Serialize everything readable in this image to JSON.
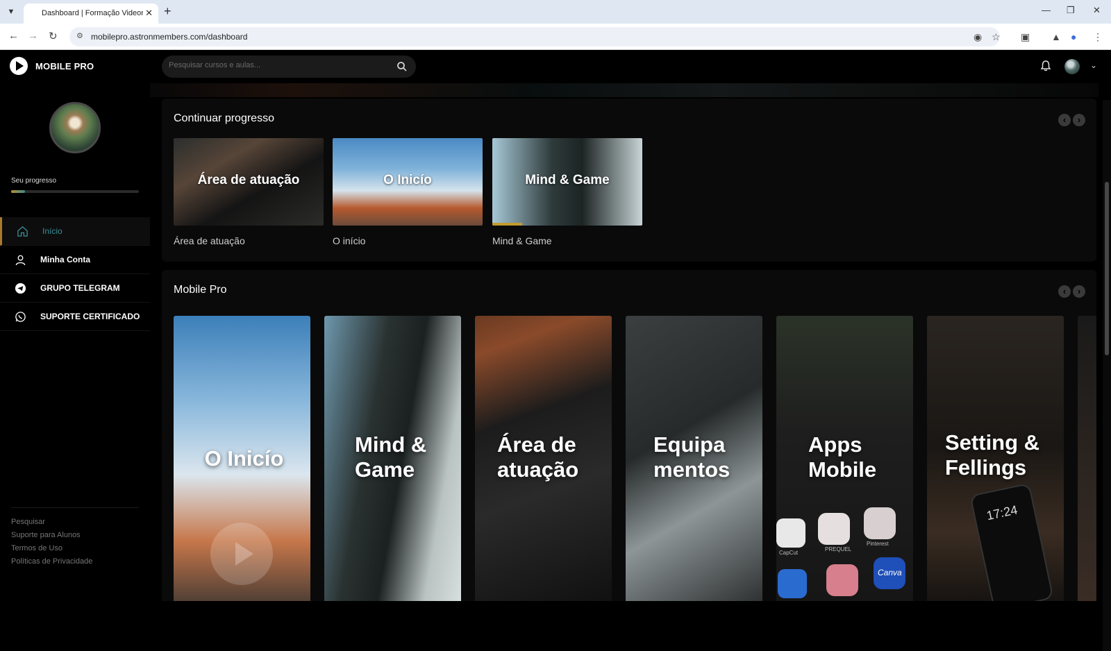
{
  "browser": {
    "tab_title": "Dashboard | Formação Videomaker Mobile Pro",
    "url": "mobilepro.astronmembers.com/dashboard"
  },
  "app": {
    "logo_text": "MOBILE PRO",
    "search_placeholder": "Pesquisar cursos e aulas..."
  },
  "sidebar": {
    "progress_label": "Seu progresso",
    "progress_value": 0.11,
    "nav": [
      {
        "label": "Início",
        "icon": "home-icon",
        "active": true
      },
      {
        "label": "Minha Conta",
        "icon": "user-icon",
        "active": false
      },
      {
        "label": "GRUPO TELEGRAM",
        "icon": "telegram-icon",
        "active": false
      },
      {
        "label": "SUPORTE CERTIFICADO",
        "icon": "whatsapp-icon",
        "active": false
      }
    ],
    "footer_links": [
      "Pesquisar",
      "Suporte para Alunos",
      "Termos de Uso",
      "Políticas de Privacidade"
    ]
  },
  "continue_section": {
    "title": "Continuar progresso",
    "cards": [
      {
        "thumb_title": "Área de atuação",
        "caption": "Área de atuação",
        "progress": 0
      },
      {
        "thumb_title": "O Inicío",
        "caption": "O início",
        "progress": 0
      },
      {
        "thumb_title": "Mind & Game",
        "caption": "Mind & Game",
        "progress": 0.2
      }
    ]
  },
  "mobile_section": {
    "title": "Mobile Pro",
    "posters": [
      {
        "title": "O Inicío"
      },
      {
        "title": "Mind & Game"
      },
      {
        "title": "Área de atuação"
      },
      {
        "title": "Equipa mentos"
      },
      {
        "title": "Apps Mobile"
      },
      {
        "title": "Setting & Fellings"
      }
    ],
    "app_labels": [
      "CapCut",
      "PREQUEL",
      "Pinterest",
      "Canva"
    ],
    "phone_time": "17:24"
  },
  "colors": {
    "accent_gold": "#a9792e",
    "accent_teal": "#3a8e98"
  }
}
